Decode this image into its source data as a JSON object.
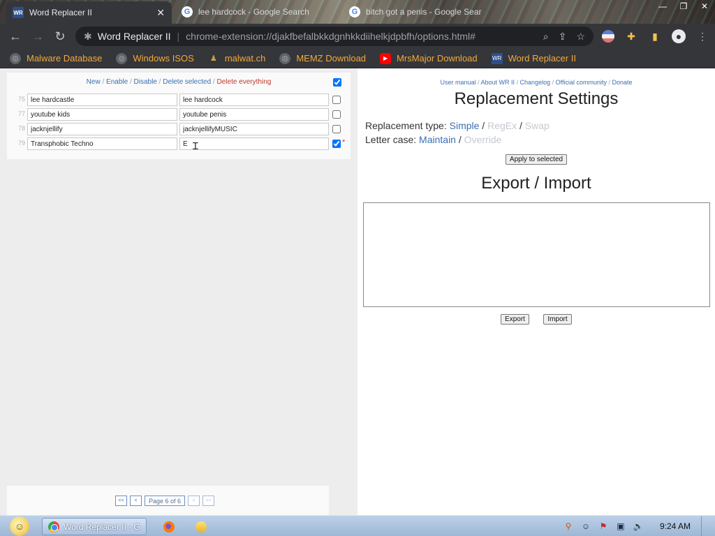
{
  "tabs": [
    {
      "title": "Word Replacer II",
      "favicon": "wr-icon",
      "active": true
    },
    {
      "title": "lee hardcock - Google Search",
      "favicon": "google-icon",
      "active": false
    },
    {
      "title": "bitch got a penis - Google Search",
      "favicon": "google-icon",
      "active": false
    }
  ],
  "toolbar": {
    "site_name": "Word Replacer II",
    "url": "chrome-extension://djakfbefalbkkdgnhkkdiihelkjdpbfh/options.html#"
  },
  "bookmarks": [
    {
      "label": "Malware Database",
      "icon": "globe-icon"
    },
    {
      "label": "Windows ISOS",
      "icon": "globe-icon"
    },
    {
      "label": "malwat.ch",
      "icon": "person-icon"
    },
    {
      "label": "MEMZ Download",
      "icon": "globe-icon"
    },
    {
      "label": "MrsMajor Download",
      "icon": "youtube-icon"
    },
    {
      "label": "Word Replacer II",
      "icon": "wr-icon"
    }
  ],
  "left": {
    "actions": {
      "new": "New",
      "enable": "Enable",
      "disable": "Disable",
      "delete_selected": "Delete selected",
      "delete_everything": "Delete everything",
      "sep": " / "
    },
    "rows": [
      {
        "num": "75",
        "source": "lee hardcastle",
        "replacement": "lee hardcock",
        "checked": false,
        "modified": false
      },
      {
        "num": "77",
        "source": "youtube kids",
        "replacement": "youtube penis",
        "checked": false,
        "modified": false
      },
      {
        "num": "78",
        "source": "jacknjellify",
        "replacement": "jacknjellifyMUSIC",
        "checked": false,
        "modified": false
      },
      {
        "num": "79",
        "source": "Transphobic Techno",
        "replacement": "E",
        "checked": true,
        "modified": true
      }
    ],
    "modified_marker": "*",
    "pager": {
      "first": "<<",
      "prev": "<",
      "label": "Page 6 of 6",
      "next": ">",
      "last": ">>"
    }
  },
  "right": {
    "links": {
      "user_manual": "User manual",
      "about": "About WR II",
      "changelog": "Changelog",
      "community": "Official community",
      "donate": "Donate",
      "sep": " / "
    },
    "settings_title": "Replacement Settings",
    "replacement_type_label": "Replacement type:",
    "type_simple": "Simple",
    "type_regex": "RegEx",
    "type_swap": "Swap",
    "letter_case_label": "Letter case:",
    "case_maintain": "Maintain",
    "case_override": "Override",
    "slash": " / ",
    "apply_button": "Apply to selected",
    "export_title": "Export / Import",
    "export_textarea": "",
    "export_button": "Export",
    "import_button": "Import"
  },
  "taskbar": {
    "active_task": "Word Replacer II - G...",
    "clock": "9:24 AM"
  },
  "colors": {
    "chrome_dark": "#35363a",
    "bookmark_text": "#f2a93b",
    "link_blue": "#3a6fb0",
    "danger_red": "#c0392b",
    "disabled_option": "#c5c9cf"
  }
}
